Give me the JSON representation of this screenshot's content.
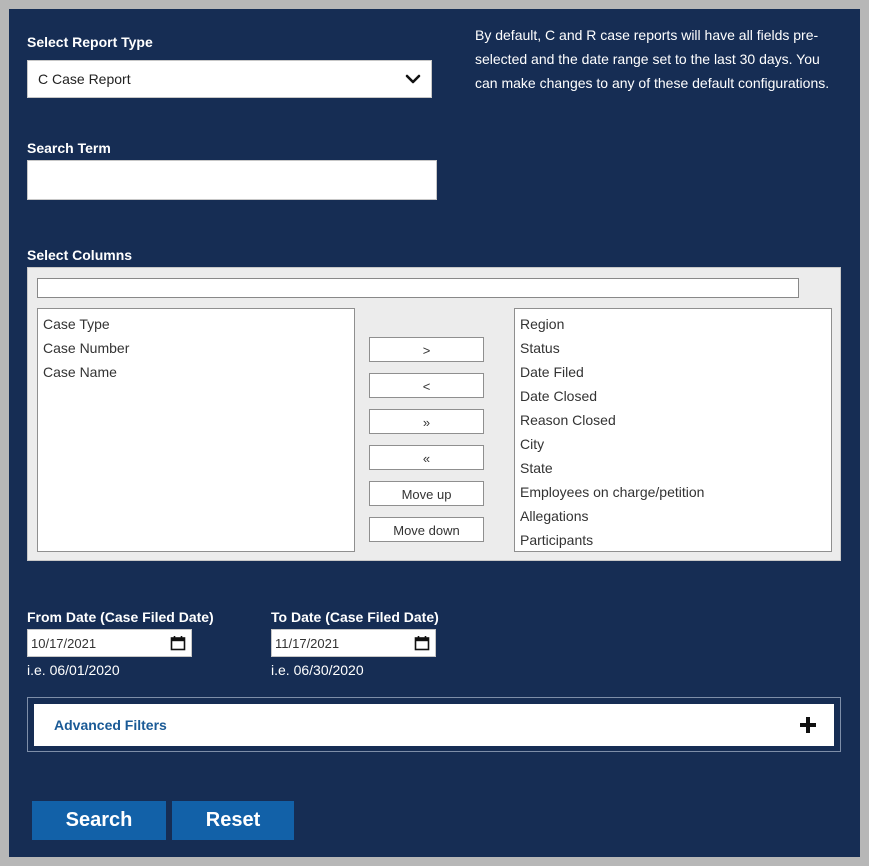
{
  "report_type": {
    "label": "Select Report Type",
    "selected": "C Case Report"
  },
  "info_text": "By default, C and R case reports will have all fields pre-selected and the date range set to the last 30 days. You can make changes to any of these default configurations.",
  "search_term": {
    "label": "Search Term",
    "value": ""
  },
  "columns": {
    "label": "Select Columns",
    "filter_value": "",
    "available": [
      "Case Type",
      "Case Number",
      "Case Name"
    ],
    "selected": [
      "Region",
      "Status",
      "Date Filed",
      "Date Closed",
      "Reason Closed",
      "City",
      "State",
      "Employees on charge/petition",
      "Allegations",
      "Participants"
    ],
    "buttons": {
      "move_right": ">",
      "move_left": "<",
      "move_all_right": "»",
      "move_all_left": "«",
      "move_up": "Move up",
      "move_down": "Move down"
    }
  },
  "from_date": {
    "label": "From Date (Case Filed Date)",
    "value": "10/17/2021",
    "hint": "i.e. 06/01/2020"
  },
  "to_date": {
    "label": "To Date (Case Filed Date)",
    "value": "11/17/2021",
    "hint": "i.e. 06/30/2020"
  },
  "advanced_filters": {
    "label": "Advanced Filters",
    "icon": "plus-icon"
  },
  "actions": {
    "search_label": "Search",
    "reset_label": "Reset"
  },
  "colors": {
    "panel_bg": "#162d54",
    "button_bg": "#1261a8",
    "link_text": "#1a5a96",
    "frame": "#b7b7b7"
  }
}
